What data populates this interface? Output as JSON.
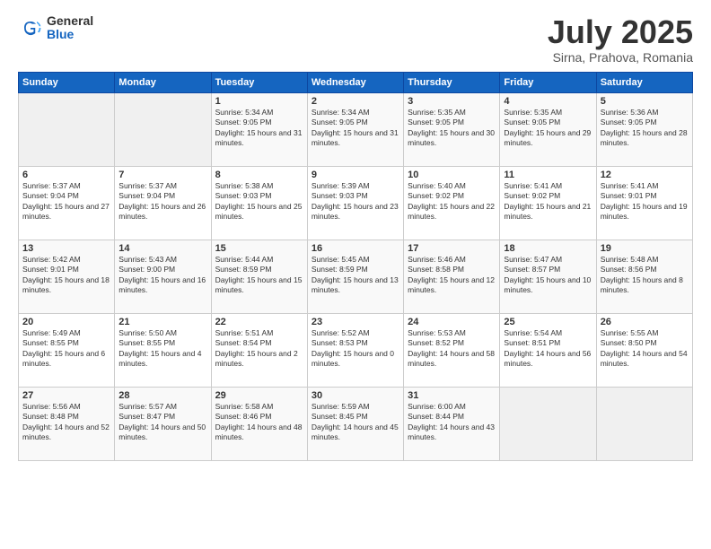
{
  "header": {
    "logo_general": "General",
    "logo_blue": "Blue",
    "month_title": "July 2025",
    "location": "Sirna, Prahova, Romania"
  },
  "weekdays": [
    "Sunday",
    "Monday",
    "Tuesday",
    "Wednesday",
    "Thursday",
    "Friday",
    "Saturday"
  ],
  "weeks": [
    [
      {
        "day": "",
        "empty": true
      },
      {
        "day": "",
        "empty": true
      },
      {
        "day": "1",
        "sunrise": "5:34 AM",
        "sunset": "9:05 PM",
        "daylight": "15 hours and 31 minutes."
      },
      {
        "day": "2",
        "sunrise": "5:34 AM",
        "sunset": "9:05 PM",
        "daylight": "15 hours and 31 minutes."
      },
      {
        "day": "3",
        "sunrise": "5:35 AM",
        "sunset": "9:05 PM",
        "daylight": "15 hours and 30 minutes."
      },
      {
        "day": "4",
        "sunrise": "5:35 AM",
        "sunset": "9:05 PM",
        "daylight": "15 hours and 29 minutes."
      },
      {
        "day": "5",
        "sunrise": "5:36 AM",
        "sunset": "9:05 PM",
        "daylight": "15 hours and 28 minutes."
      }
    ],
    [
      {
        "day": "6",
        "sunrise": "5:37 AM",
        "sunset": "9:04 PM",
        "daylight": "15 hours and 27 minutes."
      },
      {
        "day": "7",
        "sunrise": "5:37 AM",
        "sunset": "9:04 PM",
        "daylight": "15 hours and 26 minutes."
      },
      {
        "day": "8",
        "sunrise": "5:38 AM",
        "sunset": "9:03 PM",
        "daylight": "15 hours and 25 minutes."
      },
      {
        "day": "9",
        "sunrise": "5:39 AM",
        "sunset": "9:03 PM",
        "daylight": "15 hours and 23 minutes."
      },
      {
        "day": "10",
        "sunrise": "5:40 AM",
        "sunset": "9:02 PM",
        "daylight": "15 hours and 22 minutes."
      },
      {
        "day": "11",
        "sunrise": "5:41 AM",
        "sunset": "9:02 PM",
        "daylight": "15 hours and 21 minutes."
      },
      {
        "day": "12",
        "sunrise": "5:41 AM",
        "sunset": "9:01 PM",
        "daylight": "15 hours and 19 minutes."
      }
    ],
    [
      {
        "day": "13",
        "sunrise": "5:42 AM",
        "sunset": "9:01 PM",
        "daylight": "15 hours and 18 minutes."
      },
      {
        "day": "14",
        "sunrise": "5:43 AM",
        "sunset": "9:00 PM",
        "daylight": "15 hours and 16 minutes."
      },
      {
        "day": "15",
        "sunrise": "5:44 AM",
        "sunset": "8:59 PM",
        "daylight": "15 hours and 15 minutes."
      },
      {
        "day": "16",
        "sunrise": "5:45 AM",
        "sunset": "8:59 PM",
        "daylight": "15 hours and 13 minutes."
      },
      {
        "day": "17",
        "sunrise": "5:46 AM",
        "sunset": "8:58 PM",
        "daylight": "15 hours and 12 minutes."
      },
      {
        "day": "18",
        "sunrise": "5:47 AM",
        "sunset": "8:57 PM",
        "daylight": "15 hours and 10 minutes."
      },
      {
        "day": "19",
        "sunrise": "5:48 AM",
        "sunset": "8:56 PM",
        "daylight": "15 hours and 8 minutes."
      }
    ],
    [
      {
        "day": "20",
        "sunrise": "5:49 AM",
        "sunset": "8:55 PM",
        "daylight": "15 hours and 6 minutes."
      },
      {
        "day": "21",
        "sunrise": "5:50 AM",
        "sunset": "8:55 PM",
        "daylight": "15 hours and 4 minutes."
      },
      {
        "day": "22",
        "sunrise": "5:51 AM",
        "sunset": "8:54 PM",
        "daylight": "15 hours and 2 minutes."
      },
      {
        "day": "23",
        "sunrise": "5:52 AM",
        "sunset": "8:53 PM",
        "daylight": "15 hours and 0 minutes."
      },
      {
        "day": "24",
        "sunrise": "5:53 AM",
        "sunset": "8:52 PM",
        "daylight": "14 hours and 58 minutes."
      },
      {
        "day": "25",
        "sunrise": "5:54 AM",
        "sunset": "8:51 PM",
        "daylight": "14 hours and 56 minutes."
      },
      {
        "day": "26",
        "sunrise": "5:55 AM",
        "sunset": "8:50 PM",
        "daylight": "14 hours and 54 minutes."
      }
    ],
    [
      {
        "day": "27",
        "sunrise": "5:56 AM",
        "sunset": "8:48 PM",
        "daylight": "14 hours and 52 minutes."
      },
      {
        "day": "28",
        "sunrise": "5:57 AM",
        "sunset": "8:47 PM",
        "daylight": "14 hours and 50 minutes."
      },
      {
        "day": "29",
        "sunrise": "5:58 AM",
        "sunset": "8:46 PM",
        "daylight": "14 hours and 48 minutes."
      },
      {
        "day": "30",
        "sunrise": "5:59 AM",
        "sunset": "8:45 PM",
        "daylight": "14 hours and 45 minutes."
      },
      {
        "day": "31",
        "sunrise": "6:00 AM",
        "sunset": "8:44 PM",
        "daylight": "14 hours and 43 minutes."
      },
      {
        "day": "",
        "empty": true
      },
      {
        "day": "",
        "empty": true
      }
    ]
  ]
}
